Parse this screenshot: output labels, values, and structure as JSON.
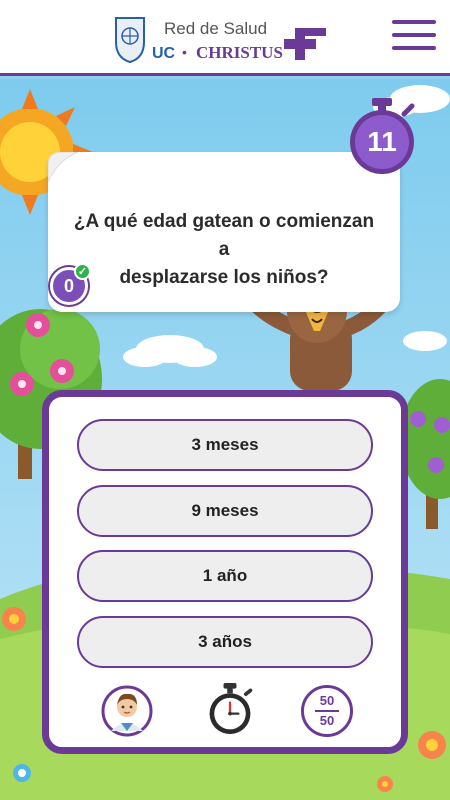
{
  "header": {
    "logo_line1": "Red de Salud",
    "logo_uc": "UC",
    "logo_dot": "•",
    "logo_christus": "CHRISTUS"
  },
  "game": {
    "timer": "11",
    "score": "0",
    "question": {
      "line1": "¿A qué edad gatean o comienzan a",
      "line2": "desplazarse los niños?"
    },
    "answers": [
      {
        "label": "3 meses"
      },
      {
        "label": "9 meses"
      },
      {
        "label": "1 año"
      },
      {
        "label": "3 años"
      }
    ],
    "lifelines": {
      "fifty_top": "50",
      "fifty_bottom": "50"
    }
  },
  "colors": {
    "brand_purple": "#6a3a96",
    "brand_blue": "#2a5fa8",
    "sky": "#8fd0f0",
    "grass": "#9bd35a"
  }
}
